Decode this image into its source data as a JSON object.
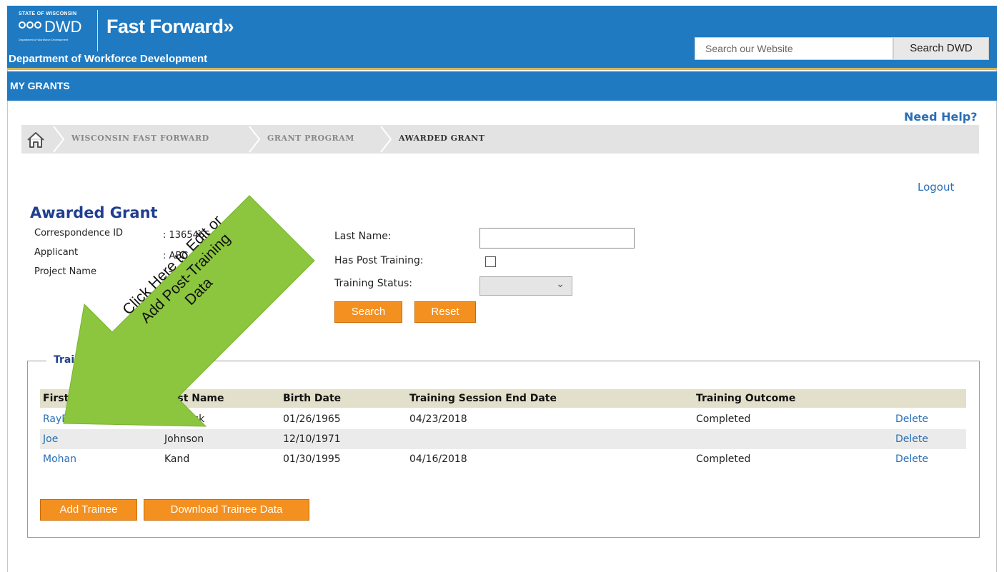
{
  "header": {
    "state_label": "STATE OF WISCONSIN",
    "dwd_label": "DWD",
    "dwd_subtext": "Department of Workforce Development",
    "program_name": "Fast Forward",
    "department_name": "Department of Workforce Development",
    "search_placeholder": "Search our Website",
    "search_button": "Search DWD",
    "brand_color": "#1f7ac2",
    "accent_color": "#d6b656"
  },
  "nav": {
    "title": "MY GRANTS"
  },
  "help_link": "Need Help?",
  "breadcrumb": {
    "home_icon": "home-icon",
    "items": [
      "WISCONSIN FAST FORWARD",
      "GRANT PROGRAM",
      "AWARDED GRANT"
    ]
  },
  "logout_link": "Logout",
  "page_title": "Awarded Grant",
  "grant_info": [
    {
      "label": "Correspondence ID",
      "value": ": 13654654"
    },
    {
      "label": "Applicant",
      "value": ": ABC"
    },
    {
      "label": "Project Name",
      "value": ": T"
    }
  ],
  "filters": {
    "last_name_label": "Last Name:",
    "last_name_value": "",
    "post_training_label": "Has Post Training:",
    "post_training_checked": false,
    "training_status_label": "Training Status:",
    "training_status_value": "",
    "search_button": "Search",
    "reset_button": "Reset"
  },
  "trainees": {
    "legend": "Trainees",
    "columns": [
      "First Name",
      "Last Name",
      "Birth Date",
      "Training Session End Date",
      "Training Outcome",
      ""
    ],
    "rows": [
      {
        "first": "RayBob",
        "last": "Hanlock",
        "birth": "01/26/1965",
        "end": "04/23/2018",
        "outcome": "Completed",
        "action": "Delete"
      },
      {
        "first": "Joe",
        "last": "Johnson",
        "birth": "12/10/1971",
        "end": "",
        "outcome": "",
        "action": "Delete"
      },
      {
        "first": "Mohan",
        "last": "Kand",
        "birth": "01/30/1995",
        "end": "04/16/2018",
        "outcome": "Completed",
        "action": "Delete"
      }
    ],
    "add_button": "Add Trainee",
    "download_button": "Download Trainee Data"
  },
  "annotation": {
    "text": "Click Here to Edit or\nAdd Post-Training\nData",
    "color": "#8cc63f"
  }
}
